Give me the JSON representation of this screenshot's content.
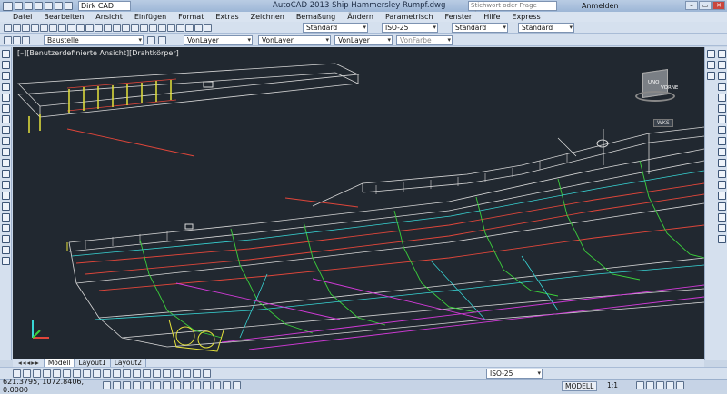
{
  "titlebar": {
    "workspace": "Dirk CAD",
    "title": "AutoCAD 2013  Ship Hammersley Rumpf.dwg",
    "search_placeholder": "Stichwort oder Frage eingeben",
    "login_label": "Anmelden",
    "minimize": "–",
    "maximize": "▭",
    "close": "✕"
  },
  "menu": [
    "Datei",
    "Bearbeiten",
    "Ansicht",
    "Einfügen",
    "Format",
    "Extras",
    "Zeichnen",
    "Bemaßung",
    "Ändern",
    "Parametrisch",
    "Fenster",
    "Hilfe",
    "Express"
  ],
  "toolbar1": {
    "text_style": "Standard",
    "dim_style": "ISO-25",
    "table_style": "Standard",
    "mleader_style": "Standard"
  },
  "toolbar2": {
    "layer": "Baustelle",
    "color": "VonLayer",
    "linetype": "VonLayer",
    "lineweight": "VonLayer",
    "plotstyle": "VonFarbe"
  },
  "viewport": {
    "label": "[–][Benutzerdefinierte Ansicht][Drahtkörper]",
    "viewcube_top": "UNO",
    "viewcube_front": "VORNE",
    "wcs_label": "WKS"
  },
  "tabs": {
    "model": "Modell",
    "layout1": "Layout1",
    "layout2": "Layout2"
  },
  "commandline": {
    "dim_style": "ISO-25"
  },
  "status": {
    "coords": "621.3795, 1072.8406, 0.0000",
    "model": "MODELL",
    "scale": "1:1"
  },
  "colors": {
    "viewport_bg": "#212830",
    "wire_white": "#d8d8d8",
    "wire_red": "#e0463a",
    "wire_green": "#3bd13b",
    "wire_yellow": "#e6e23a",
    "wire_cyan": "#38d6d6",
    "wire_magenta": "#d23ad8"
  }
}
